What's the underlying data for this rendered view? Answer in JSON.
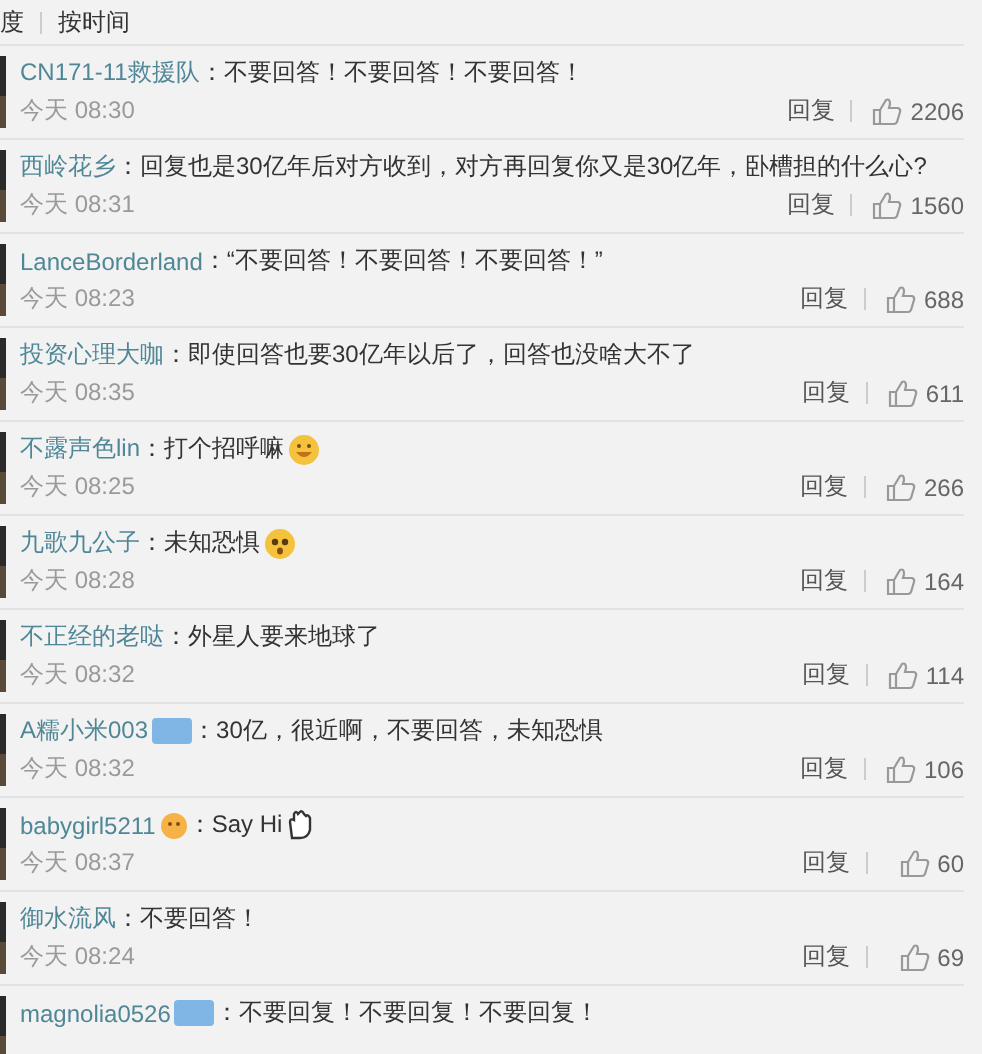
{
  "sort_tabs": [
    {
      "label": "度"
    },
    {
      "label": "按时间"
    }
  ],
  "comments": [
    {
      "user": "CN171-11救援队",
      "text": "：不要回答！不要回答！不要回答！",
      "time": "今天 08:30",
      "reply": "回复",
      "likes": "2206"
    },
    {
      "user": "西岭花乡",
      "text": "：回复也是30亿年后对方收到，对方再回复你又是30亿年，卧槽担的什么心?",
      "time": "今天 08:31",
      "reply": "回复",
      "likes": "1560"
    },
    {
      "user": "LanceBorderland",
      "text": "：“不要回答！不要回答！不要回答！”",
      "time": "今天 08:23",
      "reply": "回复",
      "likes": "688"
    },
    {
      "user": "投资心理大咖",
      "text": "：即使回答也要30亿年以后了，回答也没啥大不了",
      "time": "今天 08:35",
      "reply": "回复",
      "likes": "611"
    },
    {
      "user": "不露声色lin",
      "text": "：打个招呼嘛",
      "text_icon": {
        "kind": "grin"
      },
      "time": "今天 08:25",
      "reply": "回复",
      "likes": "266"
    },
    {
      "user": "九歌九公子",
      "text": "：未知恐惧",
      "text_icon": {
        "kind": "shock"
      },
      "time": "今天 08:28",
      "reply": "回复",
      "likes": "164"
    },
    {
      "user": "不正经的老哒",
      "text": "：外星人要来地球了",
      "time": "今天 08:32",
      "reply": "回复",
      "likes": "114"
    },
    {
      "user": "A糯小米003",
      "name_icon": {
        "kind": "badge"
      },
      "text": "：30亿，很近啊，不要回答，未知恐惧",
      "time": "今天 08:32",
      "reply": "回复",
      "likes": "106"
    },
    {
      "user": "babygirl5211",
      "name_icon": {
        "kind": "emoji"
      },
      "text": "：Say Hi",
      "text_icon": {
        "kind": "wave"
      },
      "time": "今天 08:37",
      "reply": "回复",
      "likes": "60"
    },
    {
      "user": "御水流风",
      "text": "：不要回答！",
      "time": "今天 08:24",
      "reply": "回复",
      "likes": "69"
    },
    {
      "user": "magnolia0526",
      "name_icon": {
        "kind": "badge"
      },
      "text": "：不要回复！不要回复！不要回复！"
    }
  ]
}
